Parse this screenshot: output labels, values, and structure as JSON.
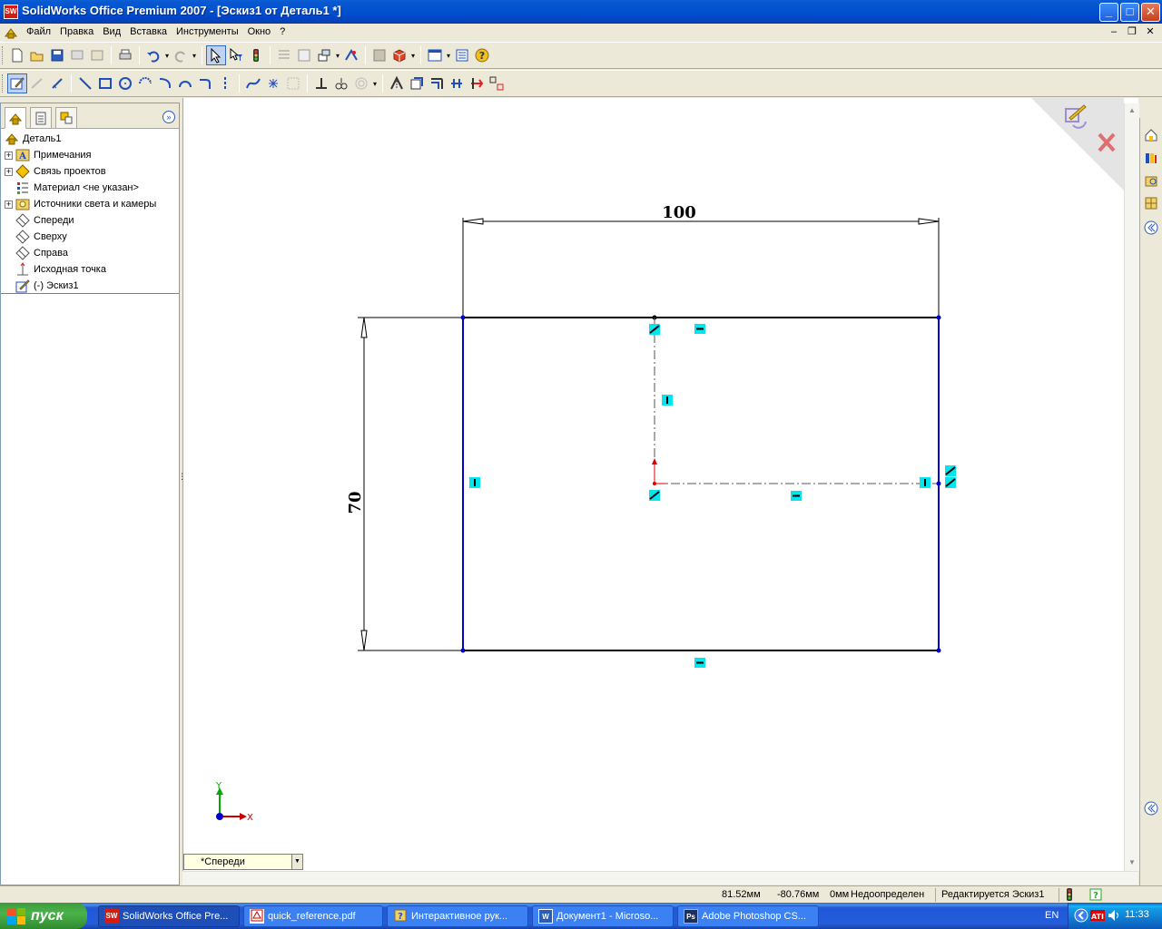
{
  "window": {
    "title": "SolidWorks Office Premium 2007 - [Эскиз1 от Деталь1 *]",
    "app_icon_text": "SW"
  },
  "menu": {
    "items": [
      "Файл",
      "Правка",
      "Вид",
      "Вставка",
      "Инструменты",
      "Окно",
      "?"
    ]
  },
  "tree": {
    "items": [
      {
        "label": "Деталь1",
        "icon": "part-icon",
        "expandable": false
      },
      {
        "label": "Примечания",
        "icon": "annotations-icon",
        "expandable": true
      },
      {
        "label": "Связь проектов",
        "icon": "design-binder-icon",
        "expandable": true
      },
      {
        "label": "Материал <не указан>",
        "icon": "material-icon",
        "expandable": false
      },
      {
        "label": "Источники света и камеры",
        "icon": "lights-cameras-icon",
        "expandable": true
      },
      {
        "label": "Спереди",
        "icon": "plane-icon",
        "expandable": false
      },
      {
        "label": "Сверху",
        "icon": "plane-icon",
        "expandable": false
      },
      {
        "label": "Справа",
        "icon": "plane-icon",
        "expandable": false
      },
      {
        "label": "Исходная точка",
        "icon": "origin-icon",
        "expandable": false
      },
      {
        "label": "(-) Эскиз1",
        "icon": "sketch-icon",
        "expandable": false
      }
    ]
  },
  "sketch": {
    "dimension_width": "100",
    "dimension_height": "70",
    "axis_x": "X",
    "axis_y": "Y"
  },
  "view_selector": {
    "value": "*Спереди"
  },
  "status": {
    "x": "81.52мм",
    "y": "-80.76мм",
    "z": "0мм",
    "state": "Недоопределен",
    "mode": "Редактируется Эскиз1"
  },
  "taskbar": {
    "start_label": "пуск",
    "tasks": [
      {
        "label": "SolidWorks Office Pre...",
        "icon": "solidworks-icon",
        "active": true
      },
      {
        "label": "quick_reference.pdf",
        "icon": "pdf-icon",
        "active": false
      },
      {
        "label": "Интерактивное рук...",
        "icon": "help-icon",
        "active": false
      },
      {
        "label": "Документ1 - Microso...",
        "icon": "word-icon",
        "active": false
      },
      {
        "label": "Adobe Photoshop CS...",
        "icon": "photoshop-icon",
        "active": false
      }
    ],
    "lang": "EN",
    "clock": "11:33"
  },
  "colors": {
    "sketch_blue": "#0000cc",
    "relation_cyan": "#00e5ee",
    "title_blue": "#0050d0"
  }
}
